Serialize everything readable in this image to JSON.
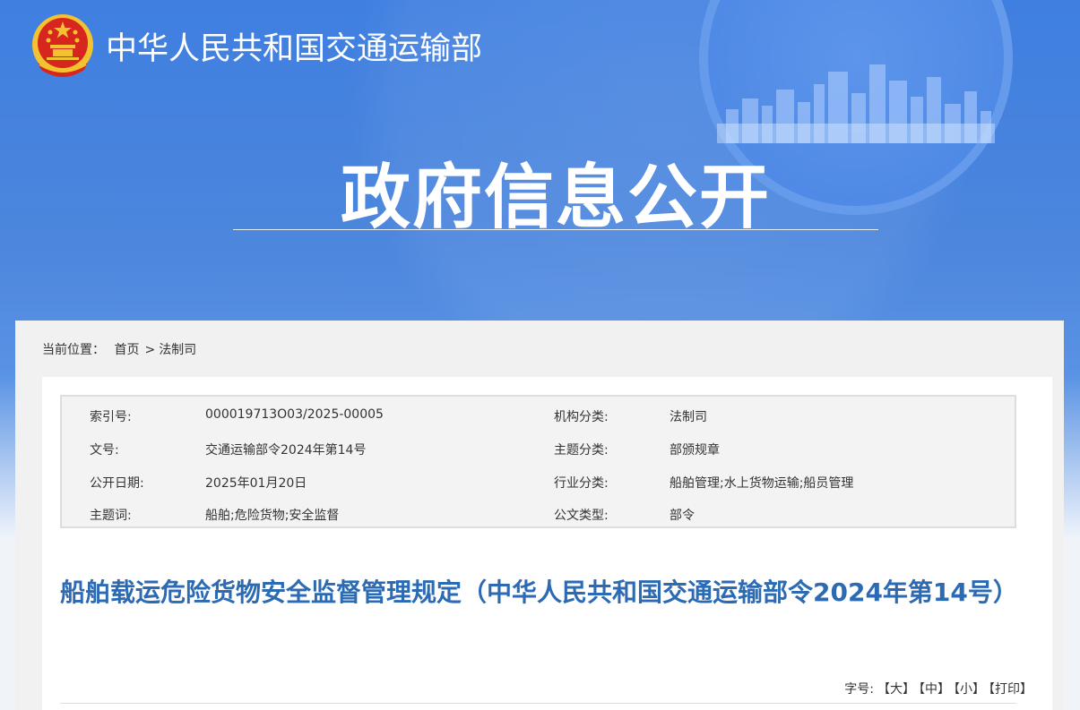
{
  "header": {
    "site_name": "中华人民共和国交通运输部",
    "section_title": "政府信息公开"
  },
  "breadcrumb": {
    "label": "当前位置：",
    "home": "首页",
    "separator": ">",
    "current": "法制司"
  },
  "meta": {
    "rows": [
      {
        "k1": "索引号:",
        "v1": "000019713O03/2025-00005",
        "k2": "机构分类:",
        "v2": "法制司"
      },
      {
        "k1": "文号:",
        "v1": "交通运输部令2024年第14号",
        "k2": "主题分类:",
        "v2": "部颁规章"
      },
      {
        "k1": "公开日期:",
        "v1": "2025年01月20日",
        "k2": "行业分类:",
        "v2": "船舶管理;水上货物运输;船员管理"
      },
      {
        "k1": "主题词:",
        "v1": "船舶;危险货物;安全监督",
        "k2": "公文类型:",
        "v2": "部令"
      }
    ]
  },
  "document": {
    "title": "船舶载运危险货物安全监督管理规定（中华人民共和国交通运输部令2024年第14号）"
  },
  "tools": {
    "label": "字号:",
    "large": "【大】",
    "medium": "【中】",
    "small": "【小】",
    "print": "【打印】"
  },
  "colors": {
    "banner_blue": "#4c86dd",
    "title_blue": "#2c6ab3",
    "emblem_red": "#d7261e",
    "emblem_gold": "#f2c230"
  }
}
